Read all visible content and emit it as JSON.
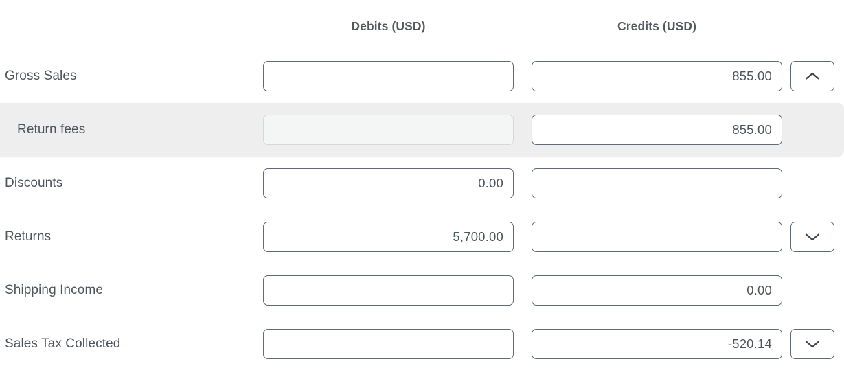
{
  "table": {
    "columns": [
      {
        "key": "label",
        "header": ""
      },
      {
        "key": "debit",
        "header": "Debits (USD)"
      },
      {
        "key": "credit",
        "header": "Credits (USD)"
      }
    ],
    "headers": {
      "debits": "Debits (USD)",
      "credits": "Credits (USD)"
    },
    "rows": [
      {
        "label": "Gross Sales",
        "debit": "",
        "credit": "855.00",
        "debit_disabled": false,
        "credit_disabled": false,
        "highlighted": false,
        "indented": false,
        "stepper": "chevron-up"
      },
      {
        "label": "Return fees",
        "debit": "",
        "credit": "855.00",
        "debit_disabled": true,
        "credit_disabled": false,
        "highlighted": true,
        "indented": true,
        "stepper": ""
      },
      {
        "label": "Discounts",
        "debit": "0.00",
        "credit": "",
        "debit_disabled": false,
        "credit_disabled": false,
        "highlighted": false,
        "indented": false,
        "stepper": ""
      },
      {
        "label": "Returns",
        "debit": "5,700.00",
        "credit": "",
        "debit_disabled": false,
        "credit_disabled": false,
        "highlighted": false,
        "indented": false,
        "stepper": "chevron-down"
      },
      {
        "label": "Shipping Income",
        "debit": "",
        "credit": "0.00",
        "debit_disabled": false,
        "credit_disabled": false,
        "highlighted": false,
        "indented": false,
        "stepper": ""
      },
      {
        "label": "Sales Tax Collected",
        "debit": "",
        "credit": "-520.14",
        "debit_disabled": false,
        "credit_disabled": false,
        "highlighted": false,
        "indented": false,
        "stepper": "chevron-down"
      }
    ]
  },
  "colors": {
    "border": "#5f6b7a",
    "text": "#4f555c",
    "header_text": "#55595f",
    "row_highlight": "#eeeeee",
    "disabled_bg": "#f4f5f5",
    "disabled_border": "#d3d8dd",
    "background": "#ffffff"
  }
}
